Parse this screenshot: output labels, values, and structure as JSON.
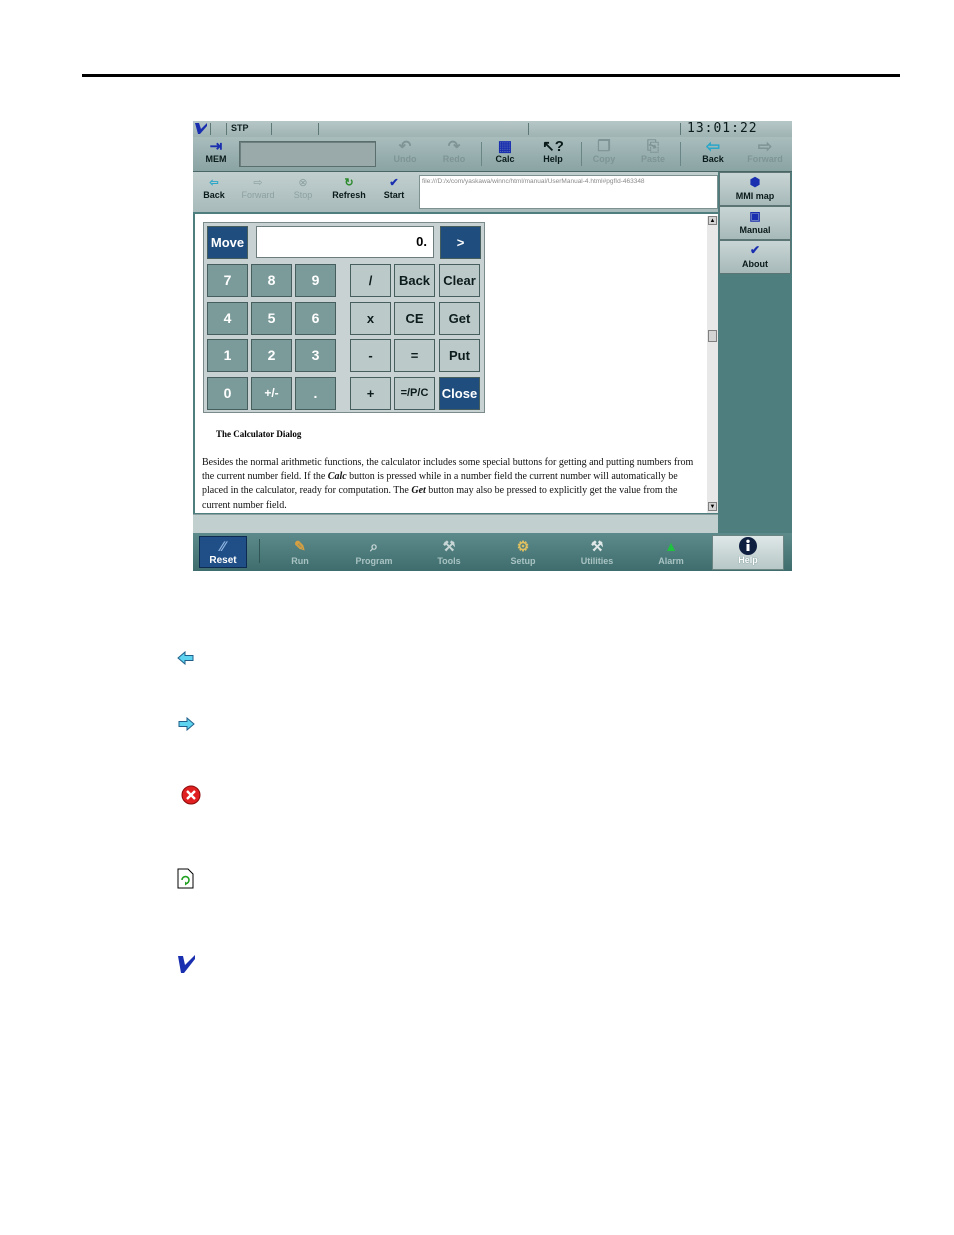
{
  "status": {
    "mode": "STP",
    "clock": "13:01:22"
  },
  "toolbar": {
    "mem": "MEM",
    "undo": "Undo",
    "redo": "Redo",
    "calc": "Calc",
    "help": "Help",
    "copy": "Copy",
    "paste": "Paste",
    "back": "Back",
    "forward": "Forward"
  },
  "nav": {
    "back": "Back",
    "forward": "Forward",
    "stop": "Stop",
    "refresh": "Refresh",
    "start": "Start",
    "url": "file:///D:/x/com/yaskawa/winnc/html/manual/UserManual-4.html#pgfId-463348"
  },
  "sidebar": {
    "mmi_map": "MMI map",
    "manual": "Manual",
    "about": "About"
  },
  "calc": {
    "move": "Move",
    "display": "0.",
    "go": ">",
    "keys": {
      "k7": "7",
      "k8": "8",
      "k9": "9",
      "k4": "4",
      "k5": "5",
      "k6": "6",
      "k1": "1",
      "k2": "2",
      "k3": "3",
      "k0": "0",
      "kpm": "+/-",
      "kdot": ".",
      "div": "/",
      "mul": "x",
      "sub": "-",
      "add": "+",
      "back": "Back",
      "ce": "CE",
      "eq": "=",
      "eqpc": "=/P/C",
      "clear": "Clear",
      "get": "Get",
      "put": "Put",
      "close": "Close"
    }
  },
  "doc": {
    "caption": "The Calculator Dialog",
    "p1": "Besides the normal arithmetic functions, the calculator includes some special buttons for getting and putting numbers from the current number field. If the ",
    "calc_word": "Calc",
    "p2": " button is pressed while in a number field the current number will automatically be placed in the calculator, ready for computation. The ",
    "get_word": "Get",
    "p3": " button may also be pressed to explicitly get the value from the current number field."
  },
  "taskbar": {
    "reset": "Reset",
    "run": "Run",
    "program": "Program",
    "tools": "Tools",
    "setup": "Setup",
    "utilities": "Utilities",
    "alarm": "Alarm",
    "help": "Help"
  },
  "colors": {
    "teal_bg": "#4e7e7e",
    "key_blue": "#1f4d7d",
    "key_num": "#7b9a9a"
  },
  "legend_icons": [
    "back-arrow-icon",
    "forward-arrow-icon",
    "stop-icon",
    "refresh-icon",
    "start-icon"
  ]
}
